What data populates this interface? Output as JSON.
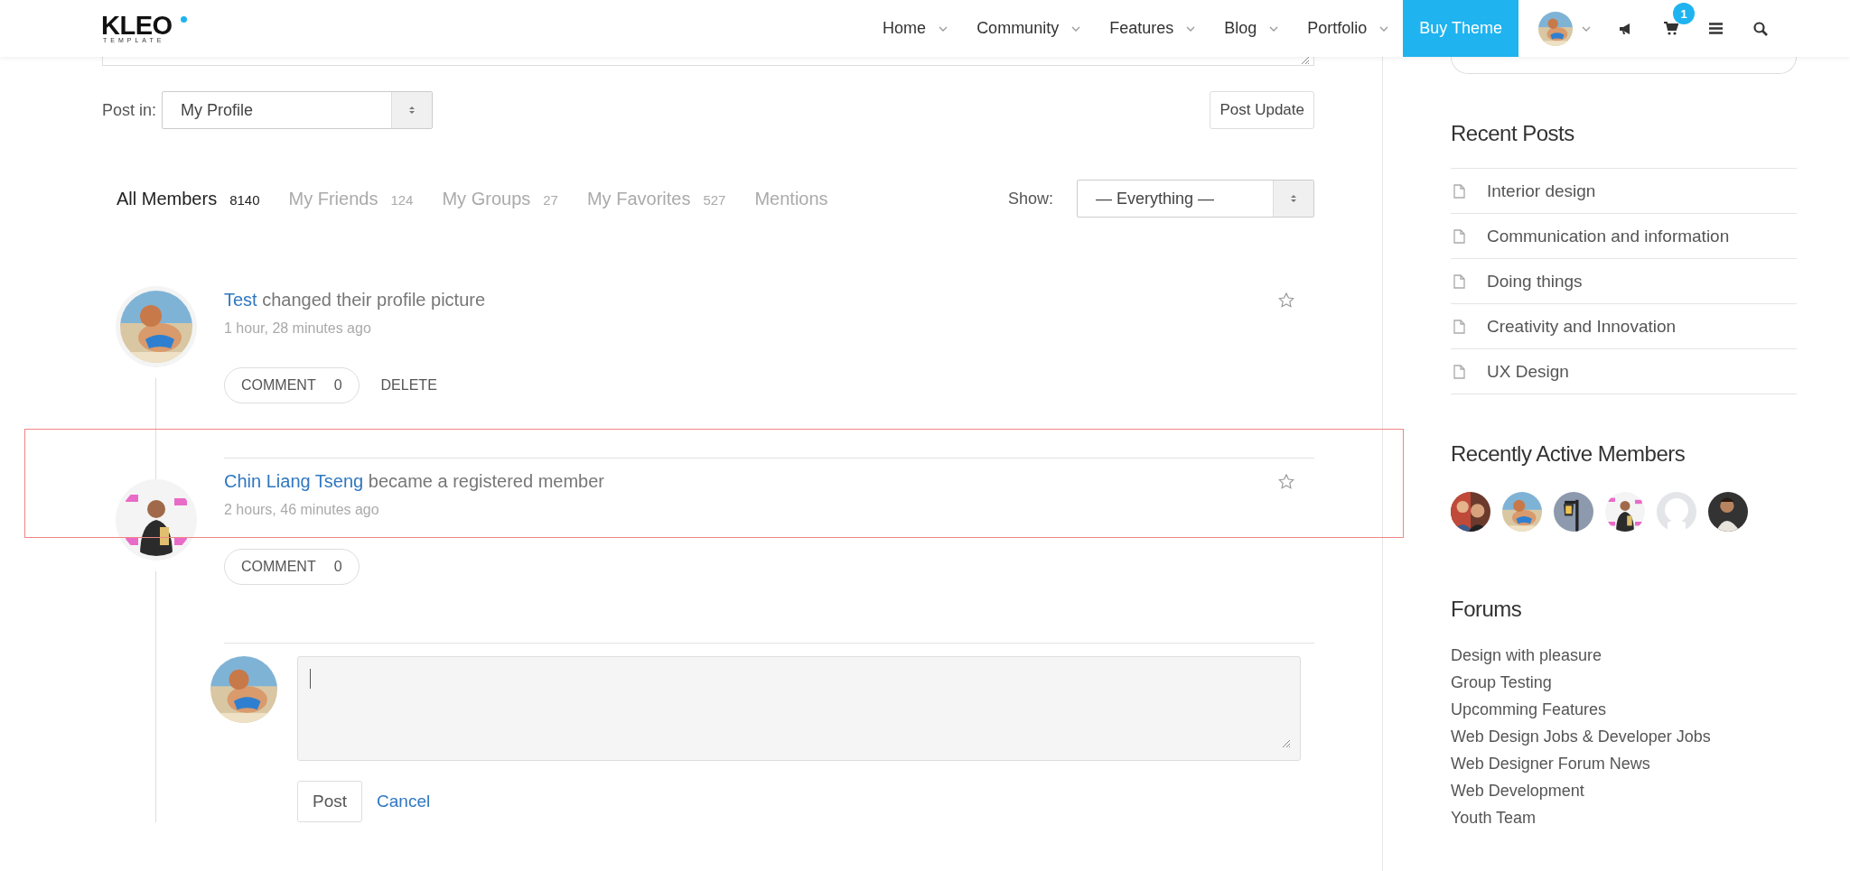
{
  "header": {
    "logo": "KLEO",
    "logo_sub": "TEMPLATE",
    "nav": [
      "Home",
      "Community",
      "Features",
      "Blog",
      "Portfolio"
    ],
    "cta": "Buy Theme",
    "cart_count": "1"
  },
  "post_form": {
    "post_in_label": "Post in:",
    "post_in_value": "My Profile",
    "submit": "Post Update"
  },
  "filter_tabs": [
    {
      "label": "All Members",
      "count": "8140",
      "selected": true
    },
    {
      "label": "My Friends",
      "count": "124",
      "selected": false
    },
    {
      "label": "My Groups",
      "count": "27",
      "selected": false
    },
    {
      "label": "My Favorites",
      "count": "527",
      "selected": false
    },
    {
      "label": "Mentions",
      "selected": false
    }
  ],
  "show": {
    "label": "Show:",
    "value": "— Everything —"
  },
  "activities": [
    {
      "author": "Test",
      "action": "changed their profile picture",
      "time": "1 hour, 28 minutes ago",
      "favorited": false,
      "highlighted": false,
      "actions": [
        {
          "kind": "pill",
          "label": "COMMENT",
          "count": "0"
        },
        {
          "kind": "plain",
          "label": "DELETE"
        }
      ]
    },
    {
      "author": "Chin Liang Tseng",
      "action": "became a registered member",
      "time": "2 hours, 46 minutes ago",
      "favorited": false,
      "highlighted": true,
      "actions": [
        {
          "kind": "pill",
          "label": "COMMENT",
          "count": "0"
        }
      ],
      "reply_form": {
        "submit": "Post",
        "cancel": "Cancel"
      }
    }
  ],
  "sidebar": {
    "recent_posts": {
      "title": "Recent Posts",
      "items": [
        "Interior design",
        "Communication and information",
        "Doing things",
        "Creativity and Innovation",
        "UX Design"
      ]
    },
    "active_members": {
      "title": "Recently Active Members",
      "members": [
        {
          "kind": "picture"
        },
        {
          "kind": "picture"
        },
        {
          "kind": "picture"
        },
        {
          "kind": "picture"
        },
        {
          "kind": "placeholder"
        },
        {
          "kind": "picture"
        }
      ]
    },
    "forums": {
      "title": "Forums",
      "items": [
        "Design with pleasure",
        "Group Testing",
        "Upcomming Features",
        "Web Design Jobs & Developer Jobs",
        "Web Designer Forum News",
        "Web Development",
        "Youth Team"
      ]
    }
  }
}
